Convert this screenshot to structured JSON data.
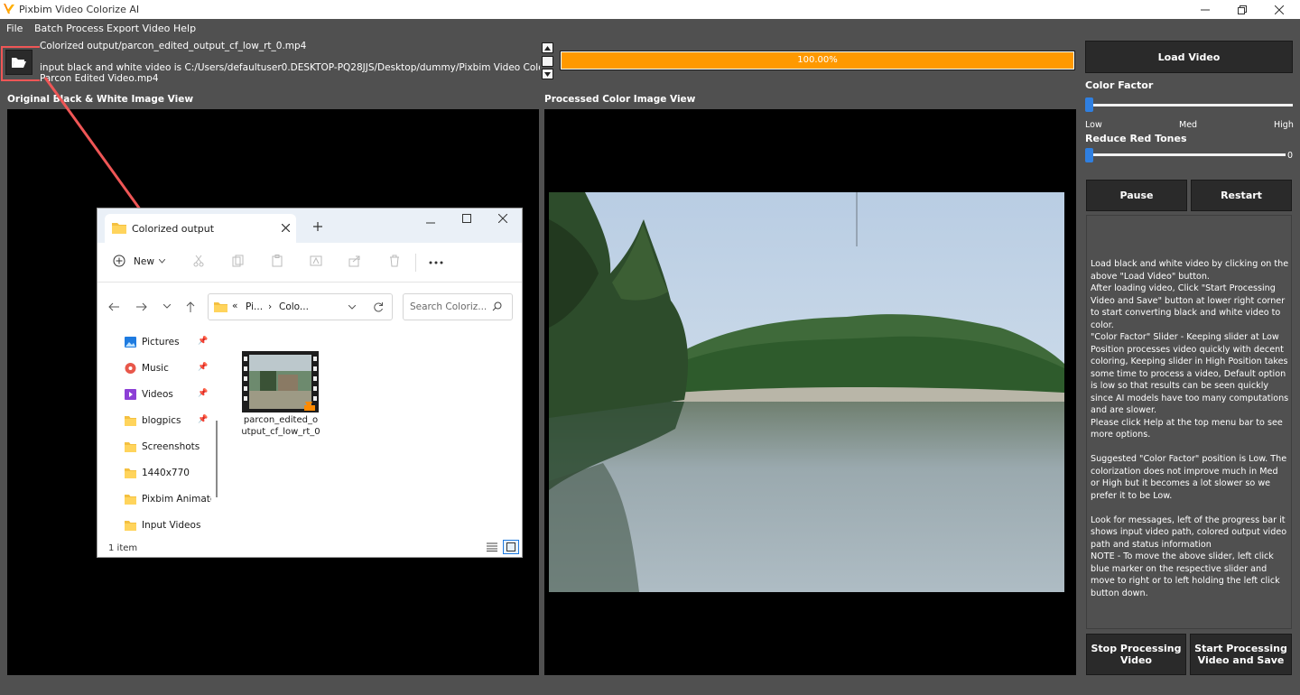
{
  "app": {
    "title": "Pixbim Video Colorize AI"
  },
  "menu": [
    "File",
    "Batch Process",
    "Export Video",
    "Help"
  ],
  "messages": [
    "Colorized output/parcon_edited_output_cf_low_rt_0.mp4",
    "input black and white video is C:/Users/defaultuser0.DESKTOP-PQ28JJS/Desktop/dummy/Pixbim Video Colorize AI/",
    "Parcon Edited Video.mp4"
  ],
  "progress": {
    "value": 1.0,
    "label": "100.00%"
  },
  "views": {
    "original_label": "Original Black & White Image View",
    "processed_label": "Processed Color Image View"
  },
  "right": {
    "load_video": "Load Video",
    "color_factor_label": "Color Factor",
    "color_factor_value": 0.0,
    "ticks": [
      "Low",
      "Med",
      "High"
    ],
    "reduce_red_label": "Reduce Red Tones",
    "reduce_red_value": "0",
    "pause": "Pause",
    "restart": "Restart",
    "stop_processing": [
      "Stop Processing",
      "Video"
    ],
    "start_processing": [
      "Start Processing",
      "Video and Save"
    ],
    "help_text": [
      "Load black and white video by clicking on the above \"Load Video\" button.",
      "After loading video, Click \"Start Processing Video and Save\" button at lower right corner to start converting black and white video to color.",
      "\"Color Factor\" Slider - Keeping slider at Low Position processes video quickly with decent coloring, Keeping slider in High Position takes some time to process a video, Default option is low so that results can be seen quickly since AI models have too many computations and are slower.",
      "Please click Help at the top menu bar to see more options.",
      "",
      "Suggested \"Color Factor\" position is Low. The colorization does not improve much in Med or High but it becomes a lot slower so we prefer it to be Low.",
      "",
      "Look for messages, left of the progress bar it shows input video path, colored output video path and status information",
      "NOTE - To move the above slider, left click blue marker on the respective slider and move to right or to left holding the left click button down."
    ]
  },
  "explorer": {
    "tab_title": "Colorized output",
    "new_label": "New",
    "breadcrumb": [
      "Pi...",
      "Colo..."
    ],
    "search_placeholder": "Search Coloriz...",
    "nav": [
      "Pictures",
      "Music",
      "Videos",
      "blogpics",
      "Screenshots",
      "1440x770",
      "Pixbim Animate",
      "Input Videos"
    ],
    "file_name": [
      "parcon_edited_o",
      "utput_cf_low_rt_0"
    ],
    "status": "1 item"
  },
  "colors": {
    "background": "#505050",
    "button": "#2a2a2a",
    "progress": "#ff9900",
    "slider_handle": "#2f7fe0",
    "annotation": "#ef5656"
  }
}
